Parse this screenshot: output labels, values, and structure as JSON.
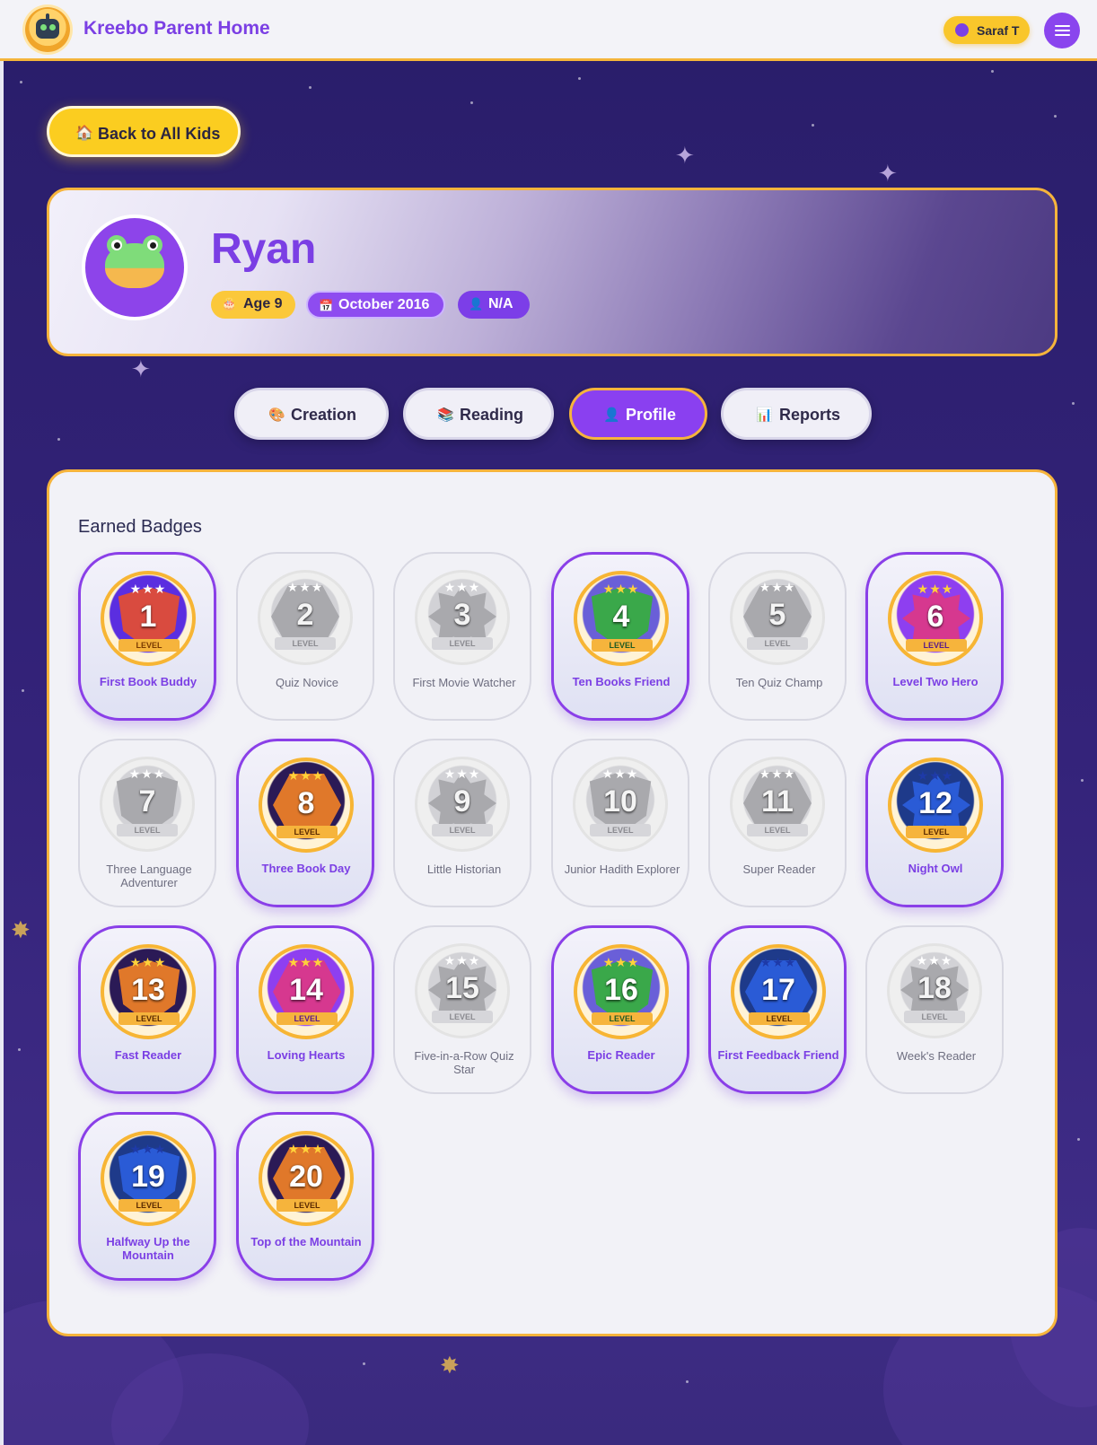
{
  "header": {
    "app_title": "Kreebo Parent Home",
    "user_name": "Saraf T",
    "logo_icon": "robot-logo",
    "menu_icon": "hamburger-menu"
  },
  "back_button": {
    "label": "Back to All Kids",
    "icon": "🏠"
  },
  "profile": {
    "name": "Ryan",
    "age": "Age 9",
    "age_icon": "🎂",
    "birth": "October 2016",
    "birth_icon": "📅",
    "gender": "N/A",
    "gender_icon": "👤",
    "avatar_icon": "frog-avatar"
  },
  "tabs": [
    {
      "label": "Creation",
      "icon": "🎨",
      "active": false
    },
    {
      "label": "Reading",
      "icon": "📚",
      "active": false
    },
    {
      "label": "Profile",
      "icon": "👤",
      "active": true
    },
    {
      "label": "Reports",
      "icon": "📊",
      "active": false
    }
  ],
  "badges_section": {
    "title": "Earned Badges",
    "badges": [
      {
        "number": "1",
        "name": "First Book Buddy",
        "earned": true
      },
      {
        "number": "2",
        "name": "Quiz Novice",
        "earned": false
      },
      {
        "number": "3",
        "name": "First Movie Watcher",
        "earned": false
      },
      {
        "number": "4",
        "name": "Ten Books Friend",
        "earned": true
      },
      {
        "number": "5",
        "name": "Ten Quiz Champ",
        "earned": false
      },
      {
        "number": "6",
        "name": "Level Two Hero",
        "earned": true
      },
      {
        "number": "7",
        "name": "Three Language Adventurer",
        "earned": false
      },
      {
        "number": "8",
        "name": "Three Book Day",
        "earned": true
      },
      {
        "number": "9",
        "name": "Little Historian",
        "earned": false
      },
      {
        "number": "10",
        "name": "Junior Hadith Explorer",
        "earned": false
      },
      {
        "number": "11",
        "name": "Super Reader",
        "earned": false
      },
      {
        "number": "12",
        "name": "Night Owl",
        "earned": true
      },
      {
        "number": "13",
        "name": "Fast Reader",
        "earned": true
      },
      {
        "number": "14",
        "name": "Loving Hearts",
        "earned": true
      },
      {
        "number": "15",
        "name": "Five-in-a-Row Quiz Star",
        "earned": false
      },
      {
        "number": "16",
        "name": "Epic Reader",
        "earned": true
      },
      {
        "number": "17",
        "name": "First Feedback Friend",
        "earned": true
      },
      {
        "number": "18",
        "name": "Week's Reader",
        "earned": false
      },
      {
        "number": "19",
        "name": "Halfway Up the Mountain",
        "earned": true
      },
      {
        "number": "20",
        "name": "Top of the Mountain",
        "earned": true
      }
    ],
    "ribbon_text": "LEVEL",
    "stars_text": "★★★"
  },
  "colors": {
    "accent": "#7b3fe4",
    "gold": "#f6b43c",
    "background": "#2b1f68"
  }
}
